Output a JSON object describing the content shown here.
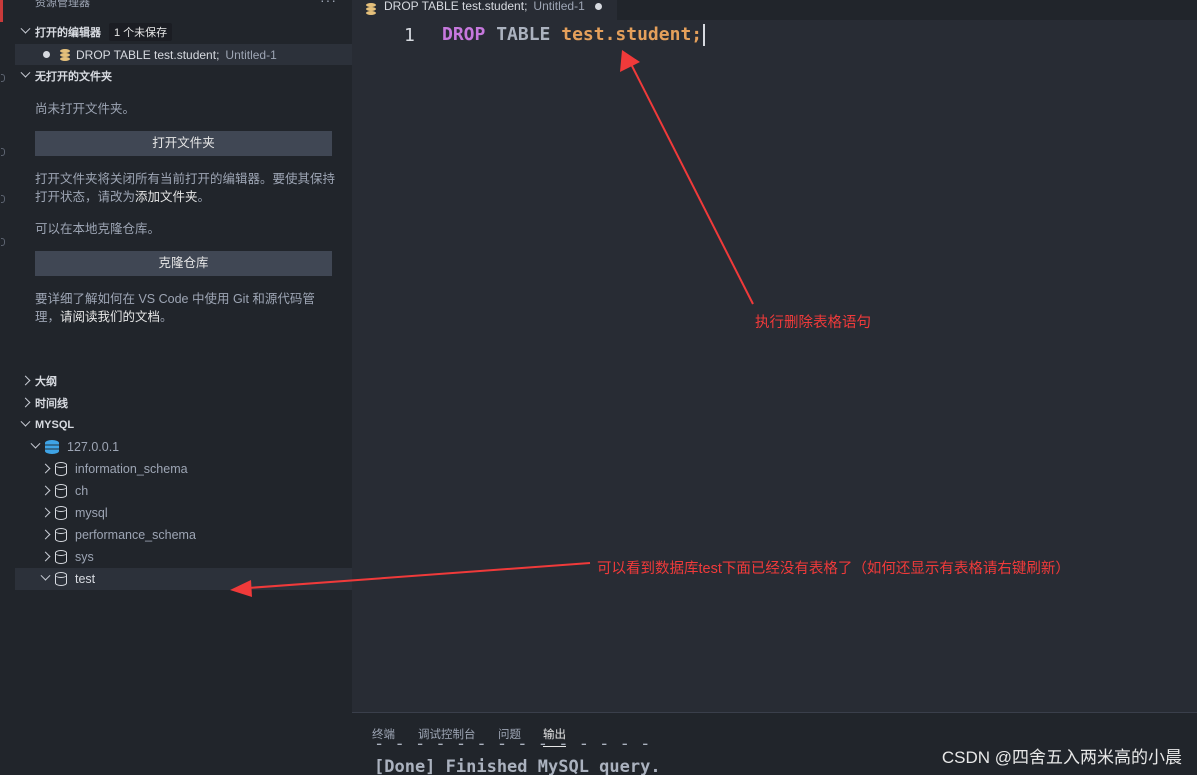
{
  "sidebar": {
    "title": "资源管理器",
    "more": "···",
    "open_editors": {
      "header": "打开的编辑器",
      "badge": "1 个未保存",
      "file_name": "DROP TABLE test.student;",
      "file_sub": "Untitled-1"
    },
    "no_folder": {
      "header": "无打开的文件夹",
      "msg1": "尚未打开文件夹。",
      "open_button": "打开文件夹",
      "msg2_a": "打开文件夹将关闭所有当前打开的编辑器。要使其保持打开状态，请改为",
      "msg2_link": "添加文件夹",
      "msg2_b": "。",
      "msg3": "可以在本地克隆仓库。",
      "clone_button": "克隆仓库",
      "msg4_a": "要详细了解如何在 VS Code 中使用 Git 和源代码管理，",
      "msg4_link": "请阅读我们的文档",
      "msg4_b": "。"
    },
    "outline": "大纲",
    "timeline": "时间线",
    "mysql": {
      "header": "MYSQL",
      "host": "127.0.0.1",
      "databases": [
        "information_schema",
        "ch",
        "mysql",
        "performance_schema",
        "sys",
        "test"
      ]
    }
  },
  "editor": {
    "tab_name": "DROP TABLE test.student;",
    "tab_sub": "Untitled-1",
    "line_number": "1",
    "code": {
      "kw": "DROP",
      "kw2": "TABLE",
      "ident": "test.student",
      "punct": ";"
    }
  },
  "panel": {
    "tabs": [
      "终端",
      "调试控制台",
      "问题",
      "输出"
    ],
    "active_tab": "输出",
    "output_cut": "- - - - - - - - - - - - - -",
    "output_line": "[Done] Finished MySQL query."
  },
  "annotations": {
    "a1": "执行删除表格语句",
    "a2": "可以看到数据库test下面已经没有表格了（如何还显示有表格请右键刷新）",
    "color": "#f03a3a"
  },
  "watermark": "CSDN @四舍五入两米高的小晨"
}
